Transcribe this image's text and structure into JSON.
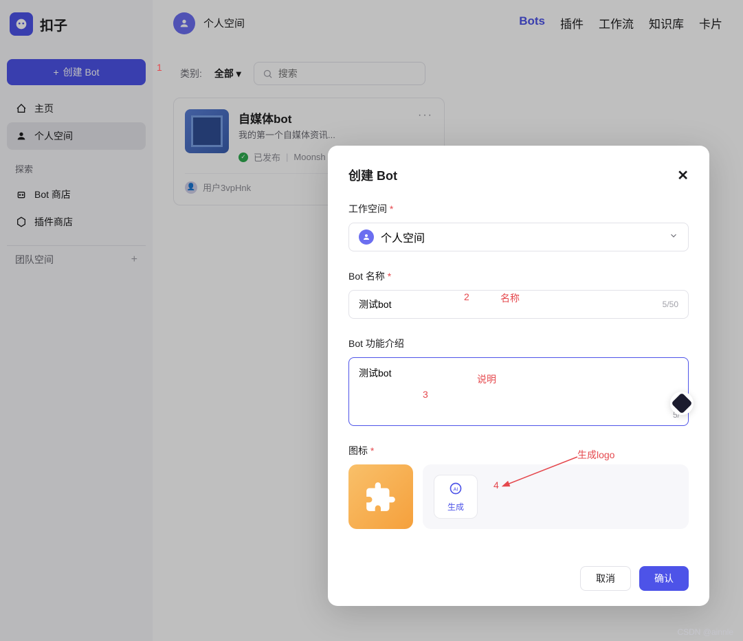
{
  "brand": "扣子",
  "sidebar": {
    "create_label": "创建 Bot",
    "nav": [
      {
        "icon": "home",
        "label": "主页"
      },
      {
        "icon": "user",
        "label": "个人空间"
      }
    ],
    "explore_label": "探索",
    "explore_items": [
      {
        "icon": "bot",
        "label": "Bot 商店"
      },
      {
        "icon": "plugin",
        "label": "插件商店"
      }
    ],
    "team_label": "团队空间"
  },
  "header": {
    "space": "个人空间",
    "tabs": [
      "Bots",
      "插件",
      "工作流",
      "知识库",
      "卡片"
    ],
    "active_tab": "Bots"
  },
  "filter": {
    "label": "类别:",
    "value": "全部",
    "search_placeholder": "搜索"
  },
  "card": {
    "title": "自媒体bot",
    "desc": "我的第一个自媒体资讯...",
    "status": "已发布",
    "model": "Moonsh",
    "user": "用户3vpHnk"
  },
  "modal": {
    "title": "创建 Bot",
    "workspace_label": "工作空间",
    "workspace_value": "个人空间",
    "name_label": "Bot 名称",
    "name_value": "测试bot",
    "name_count": "5/50",
    "desc_label": "Bot 功能介绍",
    "desc_value": "测试bot",
    "desc_count": "5/",
    "icon_label": "图标",
    "gen_label": "生成",
    "cancel_label": "取消",
    "confirm_label": "确认"
  },
  "annotations": {
    "a1": "1",
    "a2": "2",
    "a2_text": "名称",
    "a3": "3",
    "a3_text": "说明",
    "a4": "4",
    "a4_text": "生成logo"
  },
  "watermark": "CSDN @ainnle"
}
